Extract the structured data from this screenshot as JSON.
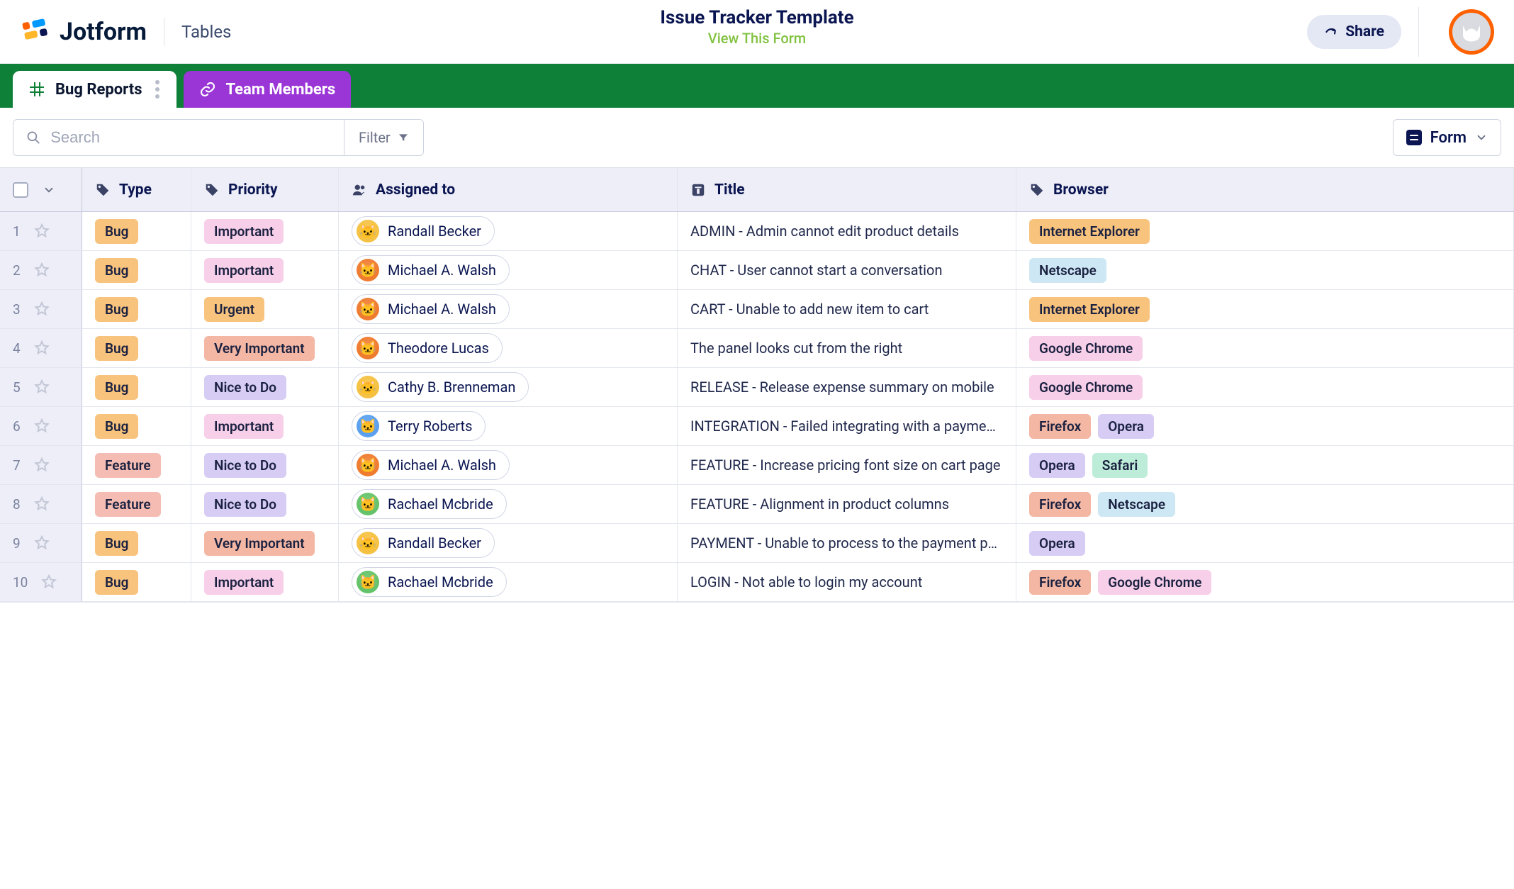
{
  "header": {
    "brand_word": "Jotform",
    "brand_sub": "Tables",
    "title": "Issue Tracker Template",
    "view_link": "View This Form",
    "share_label": "Share"
  },
  "tabs": [
    {
      "label": "Bug Reports",
      "kind": "active"
    },
    {
      "label": "Team Members",
      "kind": "purple"
    }
  ],
  "toolbar": {
    "search_placeholder": "Search",
    "filter_label": "Filter",
    "view_label": "Form"
  },
  "columns": [
    {
      "key": "type",
      "label": "Type",
      "icon": "tag"
    },
    {
      "key": "priority",
      "label": "Priority",
      "icon": "tag"
    },
    {
      "key": "assigned",
      "label": "Assigned to",
      "icon": "people"
    },
    {
      "key": "title",
      "label": "Title",
      "icon": "text"
    },
    {
      "key": "browser",
      "label": "Browser",
      "icon": "tag"
    }
  ],
  "chip_classes": {
    "Bug": "chip-bug",
    "Feature": "chip-feature",
    "Important": "chip-important",
    "Urgent": "chip-urgent",
    "Very Important": "chip-veryimportant",
    "Nice to Do": "chip-nice",
    "Internet Explorer": "chip-ie",
    "Netscape": "chip-netscape",
    "Google Chrome": "chip-chrome",
    "Firefox": "chip-firefox",
    "Opera": "chip-opera",
    "Safari": "chip-safari"
  },
  "avatar_classes": {
    "Randall Becker": "av-yellow",
    "Michael A. Walsh": "av-orange",
    "Theodore Lucas": "av-orange",
    "Cathy B. Brenneman": "av-yellow",
    "Terry Roberts": "av-blue",
    "Rachael Mcbride": "av-green"
  },
  "rows": [
    {
      "n": 1,
      "type": "Bug",
      "priority": "Important",
      "assigned": "Randall Becker",
      "title": "ADMIN - Admin cannot edit product details",
      "browsers": [
        "Internet Explorer"
      ]
    },
    {
      "n": 2,
      "type": "Bug",
      "priority": "Important",
      "assigned": "Michael A. Walsh",
      "title": "CHAT - User cannot start a conversation",
      "browsers": [
        "Netscape"
      ]
    },
    {
      "n": 3,
      "type": "Bug",
      "priority": "Urgent",
      "assigned": "Michael A. Walsh",
      "title": "CART - Unable to add new item to cart",
      "browsers": [
        "Internet Explorer"
      ]
    },
    {
      "n": 4,
      "type": "Bug",
      "priority": "Very Important",
      "assigned": "Theodore Lucas",
      "title": "The panel looks cut from the right",
      "browsers": [
        "Google Chrome"
      ]
    },
    {
      "n": 5,
      "type": "Bug",
      "priority": "Nice to Do",
      "assigned": "Cathy B. Brenneman",
      "title": "RELEASE - Release expense summary on mobile",
      "browsers": [
        "Google Chrome"
      ]
    },
    {
      "n": 6,
      "type": "Bug",
      "priority": "Important",
      "assigned": "Terry Roberts",
      "title": "INTEGRATION - Failed integrating with a payme…",
      "browsers": [
        "Firefox",
        "Opera"
      ]
    },
    {
      "n": 7,
      "type": "Feature",
      "priority": "Nice to Do",
      "assigned": "Michael A. Walsh",
      "title": "FEATURE - Increase pricing font size on cart page",
      "browsers": [
        "Opera",
        "Safari"
      ]
    },
    {
      "n": 8,
      "type": "Feature",
      "priority": "Nice to Do",
      "assigned": "Rachael Mcbride",
      "title": "FEATURE - Alignment in product columns",
      "browsers": [
        "Firefox",
        "Netscape"
      ]
    },
    {
      "n": 9,
      "type": "Bug",
      "priority": "Very Important",
      "assigned": "Randall Becker",
      "title": "PAYMENT - Unable to process to the payment pa…",
      "browsers": [
        "Opera"
      ]
    },
    {
      "n": 10,
      "type": "Bug",
      "priority": "Important",
      "assigned": "Rachael Mcbride",
      "title": "LOGIN - Not able to login my account",
      "browsers": [
        "Firefox",
        "Google Chrome"
      ]
    }
  ]
}
